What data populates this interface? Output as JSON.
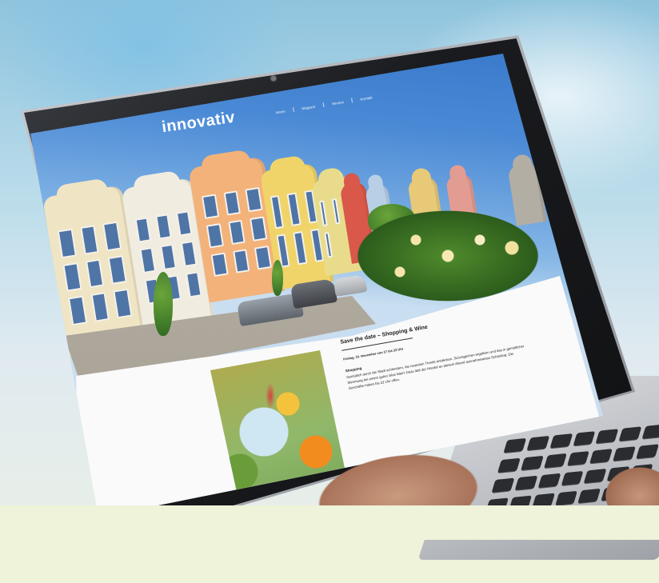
{
  "site": {
    "logo_text": "innovativ",
    "logo_tagline": "",
    "nav": [
      "Home",
      "Magazin",
      "Service",
      "Kontakt"
    ]
  },
  "article": {
    "title": "Save the date – Shopping & Wine",
    "date_line": "Freitag, 15. November von 17 bis 22 Uhr",
    "section_heading": "Shopping",
    "body": "Gemütlich durch die Stadt schlendern, die neuesten Trends entdecken, Schnäppchen ergattern und das in gemütlicher Stimmung bei einem guten Glas Wein! Dazu lädt der Handel an diesem Abend ausnahmsweise Schärding. Die Geschäfte haben bis 22 Uhr offen."
  },
  "colors": {
    "sky": "#3a7bd0",
    "page_background": "#eef3d9",
    "laptop_bezel": "#1a1b1e"
  }
}
